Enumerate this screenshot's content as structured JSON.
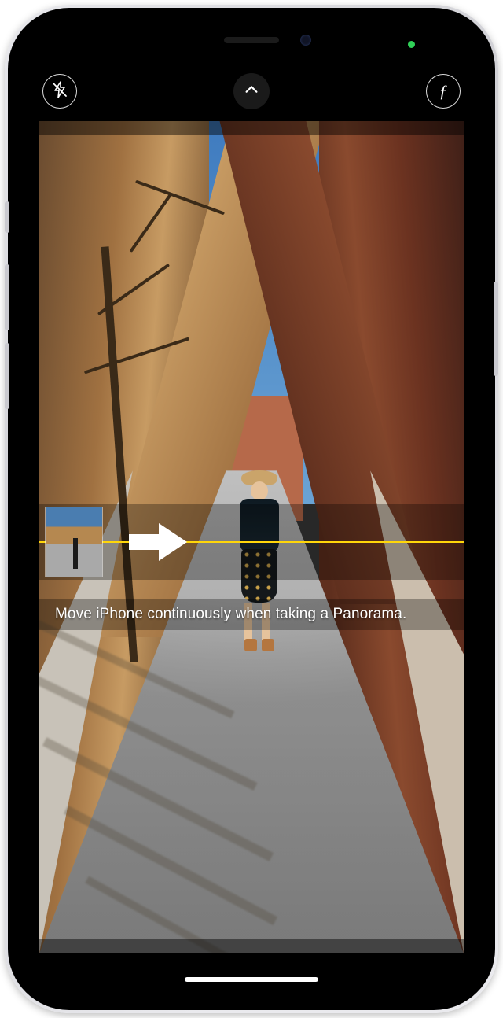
{
  "status": {
    "privacy_indicator": "camera-active"
  },
  "controls": {
    "flash": {
      "state": "off",
      "icon": "flash-off-icon"
    },
    "expand": {
      "icon": "chevron-up-icon"
    },
    "filters": {
      "icon": "f-stop-icon",
      "label": "ƒ"
    }
  },
  "panorama": {
    "direction": "right",
    "guide_line_color": "#ffd60a",
    "instruction": "Move iPhone continuously when taking a Panorama."
  }
}
